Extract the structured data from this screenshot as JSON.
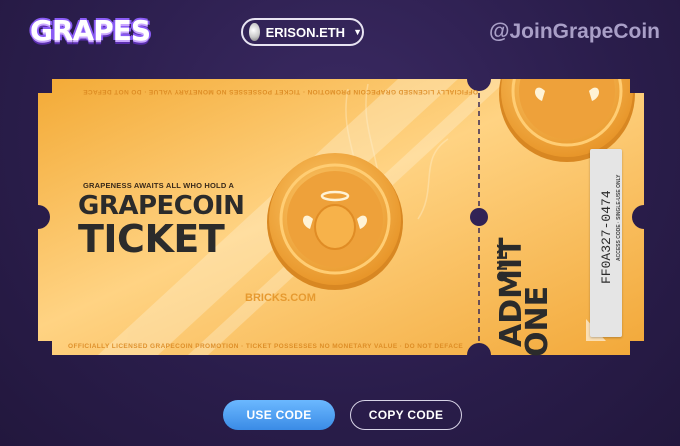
{
  "header": {
    "logo_text": "GRAPES",
    "wallet": {
      "label": "ERISON.ETH",
      "avatar_icon": "avatar-icon",
      "caret_icon": "caret-down-icon"
    },
    "social_handle": "@JoinGrapeCoin"
  },
  "ticket": {
    "fine_print_top": "OFFICIALLY LICENSED GRAPECOIN PROMOTION · TICKET POSSESSES NO MONETARY VALUE · DO NOT DEFACE",
    "fine_print_bottom": "OFFICIALLY LICENSED GRAPECOIN PROMOTION · TICKET POSSESSES NO MONETARY VALUE · DO NOT DEFACE",
    "tagline": "GRAPENESS AWAITS ALL WHO HOLD A",
    "title_line1": "GRAPECOIN",
    "title_line2": "TICKET",
    "watermark": "BRICKS.COM",
    "admit_line1": "ADMIT",
    "admit_line2": "ONE",
    "admit_only": "ONLY",
    "access_code_label": "ACCESS CODE · SINGLE-USE ONLY",
    "access_code": "FF0A327-0474",
    "coin_icon": "grapecoin-icon",
    "colors": {
      "ticket": "#f5b23d",
      "ticket_light": "#ffd27a",
      "coin": "#f0a93a",
      "ink": "#2b2b2b"
    }
  },
  "actions": {
    "use_code": "USE CODE",
    "copy_code": "COPY CODE"
  },
  "colors": {
    "background": "#2a1d4b",
    "accent_blue": "#4a9cf0"
  }
}
